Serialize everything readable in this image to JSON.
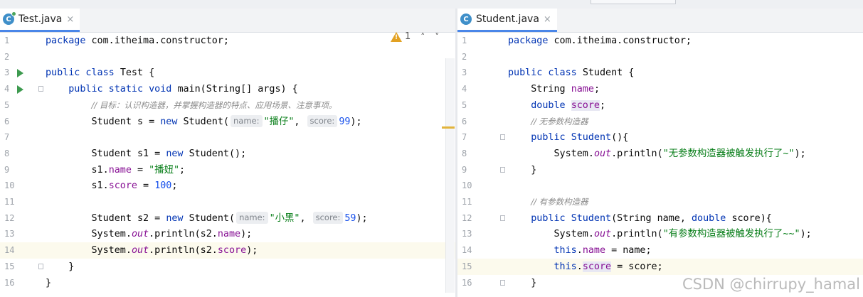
{
  "left_editor": {
    "tab": {
      "icon": "class-run-icon",
      "icon_letter": "C",
      "label": "Test.java",
      "close": "×"
    },
    "inspection": {
      "count": "1"
    },
    "lines": [
      {
        "n": "1",
        "parts": [
          {
            "t": "package ",
            "c": "kw"
          },
          {
            "t": "com.itheima.constructor;",
            "c": ""
          }
        ]
      },
      {
        "n": "2",
        "parts": []
      },
      {
        "n": "3",
        "run": true,
        "parts": [
          {
            "t": "public class ",
            "c": "kw"
          },
          {
            "t": "Test {",
            "c": ""
          }
        ]
      },
      {
        "n": "4",
        "run": true,
        "fold": true,
        "parts": [
          {
            "t": "    public static void ",
            "c": "kw"
          },
          {
            "t": "main(String[] args) {",
            "c": ""
          }
        ]
      },
      {
        "n": "5",
        "parts": [
          {
            "t": "        ",
            "c": ""
          },
          {
            "t": "// 目标：认识构造器，并掌握构造器的特点、应用场景、注意事项。",
            "c": "cmt"
          }
        ]
      },
      {
        "n": "6",
        "parts": [
          {
            "t": "        Student s = ",
            "c": ""
          },
          {
            "t": "new ",
            "c": "kw"
          },
          {
            "t": "Student(",
            "c": ""
          },
          {
            "t": "name:",
            "c": "hint"
          },
          {
            "t": "\"播仔\"",
            "c": "str"
          },
          {
            "t": ", ",
            "c": ""
          },
          {
            "t": "score:",
            "c": "hint"
          },
          {
            "t": "99",
            "c": "num"
          },
          {
            "t": ");",
            "c": ""
          }
        ]
      },
      {
        "n": "7",
        "parts": []
      },
      {
        "n": "8",
        "parts": [
          {
            "t": "        Student s1 = ",
            "c": ""
          },
          {
            "t": "new ",
            "c": "kw"
          },
          {
            "t": "Student();",
            "c": ""
          }
        ]
      },
      {
        "n": "9",
        "parts": [
          {
            "t": "        s1.",
            "c": ""
          },
          {
            "t": "name",
            "c": "fld"
          },
          {
            "t": " = ",
            "c": ""
          },
          {
            "t": "\"播妞\"",
            "c": "str"
          },
          {
            "t": ";",
            "c": ""
          }
        ]
      },
      {
        "n": "10",
        "parts": [
          {
            "t": "        s1.",
            "c": ""
          },
          {
            "t": "score",
            "c": "fld"
          },
          {
            "t": " = ",
            "c": ""
          },
          {
            "t": "100",
            "c": "num"
          },
          {
            "t": ";",
            "c": ""
          }
        ]
      },
      {
        "n": "11",
        "parts": []
      },
      {
        "n": "12",
        "parts": [
          {
            "t": "        Student s2 = ",
            "c": ""
          },
          {
            "t": "new ",
            "c": "kw"
          },
          {
            "t": "Student(",
            "c": ""
          },
          {
            "t": "name:",
            "c": "hint"
          },
          {
            "t": "\"小黑\"",
            "c": "str"
          },
          {
            "t": ", ",
            "c": ""
          },
          {
            "t": "score:",
            "c": "hint"
          },
          {
            "t": "59",
            "c": "num"
          },
          {
            "t": ");",
            "c": ""
          }
        ]
      },
      {
        "n": "13",
        "parts": [
          {
            "t": "        System.",
            "c": ""
          },
          {
            "t": "out",
            "c": "fld it"
          },
          {
            "t": ".println(s2.",
            "c": ""
          },
          {
            "t": "name",
            "c": "fld"
          },
          {
            "t": ");",
            "c": ""
          }
        ]
      },
      {
        "n": "14",
        "hl": true,
        "parts": [
          {
            "t": "        System.",
            "c": ""
          },
          {
            "t": "out",
            "c": "fld it"
          },
          {
            "t": ".println(s2.",
            "c": ""
          },
          {
            "t": "score",
            "c": "fld"
          },
          {
            "t": ");",
            "c": ""
          }
        ]
      },
      {
        "n": "15",
        "fold": true,
        "parts": [
          {
            "t": "    }",
            "c": ""
          }
        ]
      },
      {
        "n": "16",
        "parts": [
          {
            "t": "}",
            "c": ""
          }
        ]
      }
    ]
  },
  "right_editor": {
    "tab": {
      "icon": "class-icon",
      "icon_letter": "C",
      "label": "Student.java",
      "close": "×"
    },
    "lines": [
      {
        "n": "1",
        "parts": [
          {
            "t": "package ",
            "c": "kw"
          },
          {
            "t": "com.itheima.constructor;",
            "c": ""
          }
        ]
      },
      {
        "n": "2",
        "parts": []
      },
      {
        "n": "3",
        "parts": [
          {
            "t": "public class ",
            "c": "kw"
          },
          {
            "t": "Student {",
            "c": ""
          }
        ]
      },
      {
        "n": "4",
        "parts": [
          {
            "t": "    String ",
            "c": ""
          },
          {
            "t": "name",
            "c": "fld"
          },
          {
            "t": ";",
            "c": ""
          }
        ]
      },
      {
        "n": "5",
        "parts": [
          {
            "t": "    ",
            "c": ""
          },
          {
            "t": "double ",
            "c": "kw"
          },
          {
            "t": "score",
            "c": "fld hl-word"
          },
          {
            "t": ";",
            "c": ""
          }
        ]
      },
      {
        "n": "6",
        "parts": [
          {
            "t": "    ",
            "c": ""
          },
          {
            "t": "// 无参数构造器",
            "c": "cmt"
          }
        ]
      },
      {
        "n": "7",
        "fold": true,
        "parts": [
          {
            "t": "    ",
            "c": ""
          },
          {
            "t": "public ",
            "c": "kw"
          },
          {
            "t": "Student",
            "c": "kw"
          },
          {
            "t": "(){",
            "c": ""
          }
        ]
      },
      {
        "n": "8",
        "parts": [
          {
            "t": "        System.",
            "c": ""
          },
          {
            "t": "out",
            "c": "fld it"
          },
          {
            "t": ".println(",
            "c": ""
          },
          {
            "t": "\"无参数构造器被触发执行了~\"",
            "c": "str"
          },
          {
            "t": ");",
            "c": ""
          }
        ]
      },
      {
        "n": "9",
        "fold": true,
        "parts": [
          {
            "t": "    }",
            "c": ""
          }
        ]
      },
      {
        "n": "10",
        "parts": []
      },
      {
        "n": "11",
        "parts": [
          {
            "t": "    ",
            "c": ""
          },
          {
            "t": "// 有参数构造器",
            "c": "cmt"
          }
        ]
      },
      {
        "n": "12",
        "fold": true,
        "parts": [
          {
            "t": "    ",
            "c": ""
          },
          {
            "t": "public ",
            "c": "kw"
          },
          {
            "t": "Student",
            "c": "kw"
          },
          {
            "t": "(String name, ",
            "c": ""
          },
          {
            "t": "double ",
            "c": "kw"
          },
          {
            "t": "score){",
            "c": ""
          }
        ]
      },
      {
        "n": "13",
        "parts": [
          {
            "t": "        System.",
            "c": ""
          },
          {
            "t": "out",
            "c": "fld it"
          },
          {
            "t": ".println(",
            "c": ""
          },
          {
            "t": "\"有参数构造器被触发执行了~~\"",
            "c": "str"
          },
          {
            "t": ");",
            "c": ""
          }
        ]
      },
      {
        "n": "14",
        "parts": [
          {
            "t": "        ",
            "c": ""
          },
          {
            "t": "this",
            "c": "kw"
          },
          {
            "t": ".",
            "c": ""
          },
          {
            "t": "name",
            "c": "fld"
          },
          {
            "t": " = name;",
            "c": ""
          }
        ]
      },
      {
        "n": "15",
        "hl": true,
        "parts": [
          {
            "t": "        ",
            "c": ""
          },
          {
            "t": "this",
            "c": "kw"
          },
          {
            "t": ".",
            "c": ""
          },
          {
            "t": "score",
            "c": "fld hl-word"
          },
          {
            "t": " = score;",
            "c": ""
          }
        ]
      },
      {
        "n": "16",
        "fold": true,
        "parts": [
          {
            "t": "    }",
            "c": ""
          }
        ]
      }
    ]
  },
  "watermark": "CSDN @chirrupy_hamal",
  "colors": {
    "keyword": "#0033b3",
    "string": "#067d17",
    "number": "#1750eb",
    "field": "#871094",
    "comment": "#8c8c8c"
  }
}
